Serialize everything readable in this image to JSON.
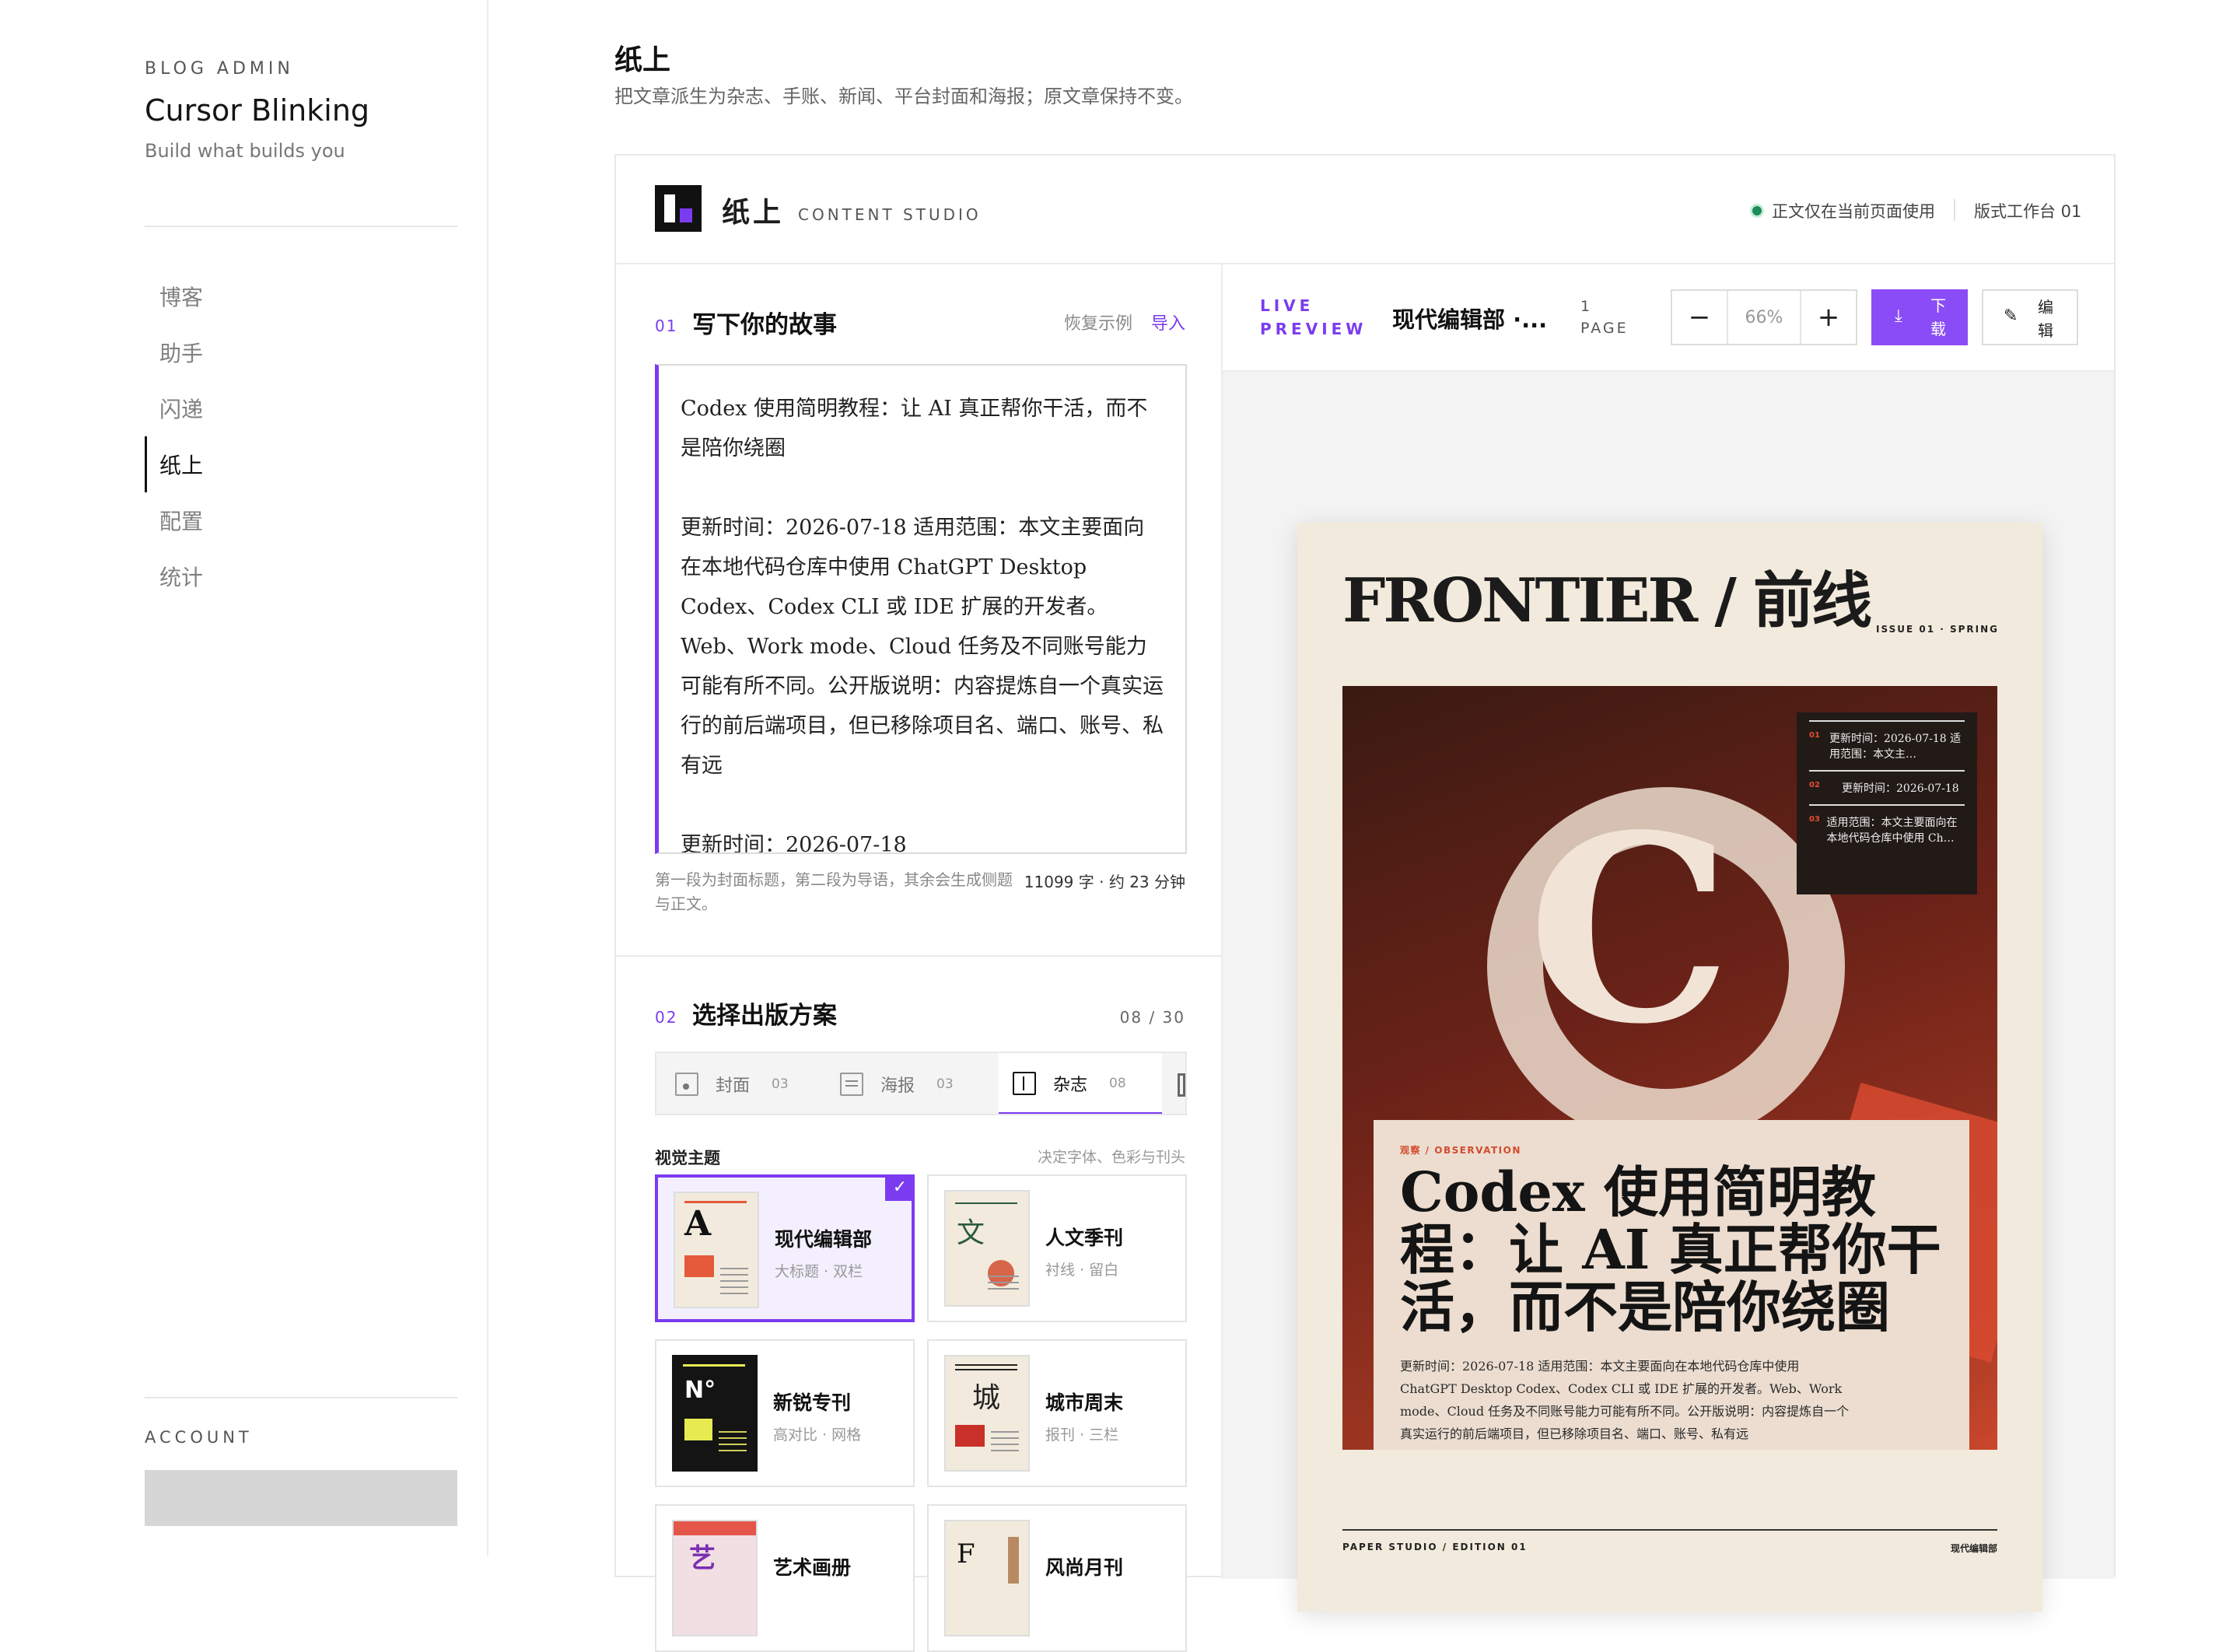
{
  "sidebar": {
    "kicker": "BLOG ADMIN",
    "title": "Cursor Blinking",
    "subtitle": "Build what builds you",
    "nav": [
      "博客",
      "助手",
      "闪递",
      "纸上",
      "配置",
      "统计"
    ],
    "active_nav": "纸上",
    "account_label": "ACCOUNT"
  },
  "header": {
    "title": "纸上",
    "subtitle": "把文章派生为杂志、手账、新闻、平台封面和海报；原文章保持不变。"
  },
  "studio": {
    "name": "纸上",
    "tagline": "CONTENT STUDIO",
    "status_note": "正文仅在当前页面使用",
    "workspace": "版式工作台 01",
    "status_color": "#1a8d5a"
  },
  "compose": {
    "num": "01",
    "title": "写下你的故事",
    "restore_label": "恢复示例",
    "import_label": "导入",
    "paragraphs": [
      "Codex 使用简明教程：让 AI 真正帮你干活，而不是陪你绕圈",
      "更新时间：2026-07-18 适用范围：本文主要面向在本地代码仓库中使用 ChatGPT Desktop Codex、Codex CLI 或 IDE 扩展的开发者。Web、Work mode、Cloud 任务及不同账号能力可能有所不同。公开版说明：内容提炼自一个真实运行的前后端项目，但已移除项目名、端口、账号、私有远",
      "更新时间：2026-07-18"
    ],
    "help": "第一段为封面标题，第二段为导语，其余会生成侧题与正文。",
    "count": "11099 字 · 约 23 分钟"
  },
  "publish": {
    "num": "02",
    "title": "选择出版方案",
    "count": "08 / 30",
    "tabs": [
      {
        "label": "封面",
        "count": "03",
        "icon": "cover-icon"
      },
      {
        "label": "海报",
        "count": "03",
        "icon": "poster-icon"
      },
      {
        "label": "杂志",
        "count": "08",
        "icon": "magazine-icon"
      }
    ],
    "active_tab": "杂志",
    "theme_label": "视觉主题",
    "theme_hint": "决定字体、色彩与刊头",
    "themes": [
      {
        "name": "现代编辑部",
        "sub": "大标题 · 双栏",
        "glyph": "A",
        "selected": true
      },
      {
        "name": "人文季刊",
        "sub": "衬线 · 留白",
        "glyph": "文"
      },
      {
        "name": "新锐专刊",
        "sub": "高对比 · 网格",
        "glyph": "N°"
      },
      {
        "name": "城市周末",
        "sub": "报刊 · 三栏",
        "glyph": "城"
      },
      {
        "name": "艺术画册",
        "sub": "",
        "glyph": "艺"
      },
      {
        "name": "风尚月刊",
        "sub": "",
        "glyph": "F"
      }
    ],
    "check": "✓"
  },
  "preview": {
    "live_label": "LIVE PREVIEW",
    "theme": "现代编辑部 ·...",
    "pages": "1 PAGE",
    "zoom": "66%",
    "zoom_out": "−",
    "zoom_in": "+",
    "download_label": "下载",
    "edit_label": "编辑",
    "accent": "#8a4cf6"
  },
  "poster": {
    "masthead": "FRONTIER / 前线",
    "issue": "ISSUE 01 · SPRING",
    "big_letter": "C",
    "toc": [
      {
        "n": "01",
        "t": "更新时间：2026-07-18 适用范围：本文主…"
      },
      {
        "n": "02",
        "t": "更新时间：2026-07-18"
      },
      {
        "n": "03",
        "t": "适用范围：本文主要面向在本地代码仓库中使用 Ch…"
      }
    ],
    "kicker": "观察 / OBSERVATION",
    "headline": "Codex 使用简明教程：让 AI 真正帮你干活，而不是陪你绕圈",
    "lede": "更新时间：2026-07-18 适用范围：本文主要面向在本地代码仓库中使用 ChatGPT Desktop Codex、Codex CLI 或 IDE 扩展的开发者。Web、Work mode、Cloud 任务及不同账号能力可能有所不同。公开版说明：内容提炼自一个真实运行的前后端项目，但已移除项目名、端口、账号、私有远",
    "footer_left": "PAPER STUDIO / EDITION 01",
    "footer_right": "现代编辑部"
  }
}
